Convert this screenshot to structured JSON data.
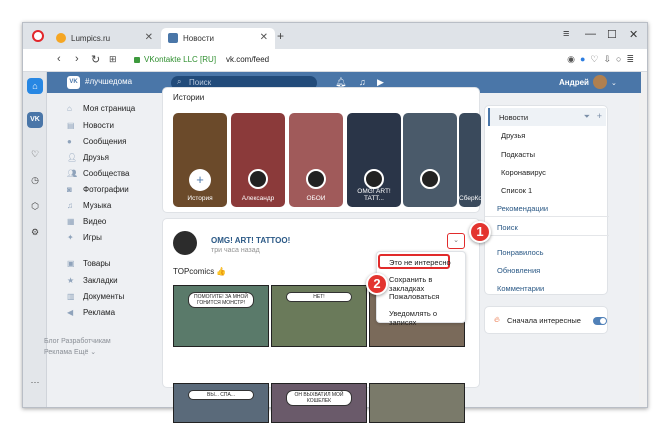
{
  "browser": {
    "tabs": [
      {
        "label": "Lumpics.ru"
      },
      {
        "label": "Новости"
      }
    ],
    "new_tab": "+",
    "address": {
      "site_label": "VKontakte LLC [RU]",
      "url": "vk.com/feed"
    }
  },
  "vk": {
    "header": {
      "tag": "#лучшедома",
      "search_placeholder": "Поиск",
      "user": "Андрей"
    },
    "left_nav": [
      {
        "label": "Моя страница",
        "icon": "home-icon"
      },
      {
        "label": "Новости",
        "icon": "news-icon"
      },
      {
        "label": "Сообщения",
        "icon": "chat-icon",
        "count": "1"
      },
      {
        "label": "Друзья",
        "icon": "friends-icon",
        "count": "4"
      },
      {
        "label": "Сообщества",
        "icon": "groups-icon"
      },
      {
        "label": "Фотографии",
        "icon": "camera-icon"
      },
      {
        "label": "Музыка",
        "icon": "music-icon"
      },
      {
        "label": "Видео",
        "icon": "video-icon"
      },
      {
        "label": "Игры",
        "icon": "games-icon",
        "count": "6"
      },
      {
        "label": "Товары",
        "icon": "bag-icon"
      },
      {
        "label": "Закладки",
        "icon": "star-icon"
      },
      {
        "label": "Документы",
        "icon": "doc-icon"
      },
      {
        "label": "Реклама",
        "icon": "megaphone-icon"
      }
    ],
    "footer": {
      "line1": "Блог  Разработчикам",
      "line2": "Реклама  Ещё ⌄"
    },
    "stories": {
      "title": "Истории",
      "items": [
        {
          "label": "История",
          "color": "#6b4a2a"
        },
        {
          "label": "Александр",
          "color": "#8b3a3a"
        },
        {
          "label": "ОБОИ",
          "color": "#a05a5a"
        },
        {
          "label": "OMG! ART! TATT...",
          "color": "#2a3548"
        },
        {
          "label": "",
          "color": "#4a5a6a"
        },
        {
          "label": "СберКот",
          "color": "#3a4a5c"
        }
      ]
    },
    "post": {
      "author": "OMG! ART! TATTOO!",
      "time": "три часа назад",
      "text": "TOPcomics 👍",
      "comic": [
        {
          "bubble": "ПОМОГИТЕ! ЗА МНОЙ ГОНИТСЯ МОНСТР!",
          "color": "#5a7a6a"
        },
        {
          "bubble": "НЕТ!",
          "color": "#6a7a5a"
        },
        {
          "bubble": "",
          "color": "#7a6a5a"
        },
        {
          "bubble": "ВЫ... СПА...",
          "color": "#5a6a7a"
        },
        {
          "bubble": "ОН ВЫХВАТИЛ МОЙ КОШЕЛЕК",
          "color": "#6a5a6a"
        },
        {
          "bubble": "",
          "color": "#7a7a6a"
        }
      ]
    },
    "post_menu": [
      {
        "label": "Это не интересно"
      },
      {
        "label": "Сохранить в закладках"
      },
      {
        "label": "Пожаловаться"
      },
      {
        "label": "Уведомлять о записях"
      }
    ],
    "right_nav": {
      "items": [
        {
          "label": "Новости"
        },
        {
          "label": "Друзья"
        },
        {
          "label": "Подкасты"
        },
        {
          "label": "Коронавирус"
        },
        {
          "label": "Список 1"
        },
        {
          "label": "Рекомендации"
        },
        {
          "label": "Поиск"
        },
        {
          "label": "Понравилось"
        },
        {
          "label": "Обновления"
        },
        {
          "label": "Комментарии"
        }
      ],
      "filter": "Сначала интересные"
    }
  },
  "annotations": {
    "badge1": "1",
    "badge2": "2"
  }
}
